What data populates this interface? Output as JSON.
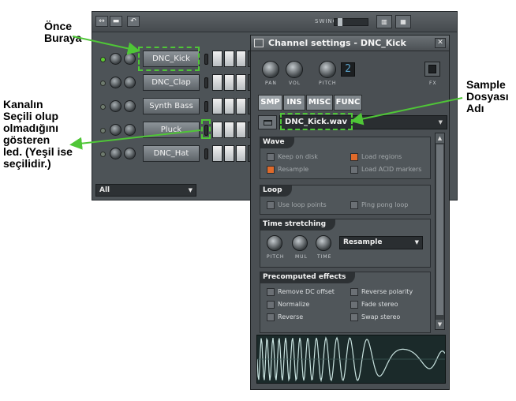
{
  "annotations": {
    "once": "Önce\nBuraya",
    "kanal": "Kanalın\nSeçili olup\nolmadığını\ngösteren\nled. (Yeşil ise\nseçilidir.)",
    "sample": "Sample\nDosyası\nAdı"
  },
  "rack": {
    "swing_label": "SWING",
    "channels": [
      {
        "name": "DNC_Kick",
        "selected": true
      },
      {
        "name": "DNC_Clap",
        "selected": false
      },
      {
        "name": "Synth Bass",
        "selected": false
      },
      {
        "name": "Pluck",
        "selected": false
      },
      {
        "name": "DNC_Hat",
        "selected": false
      }
    ],
    "filter": "All"
  },
  "channel_settings": {
    "title": "Channel settings - DNC_Kick",
    "knob_labels": {
      "pan": "PAN",
      "vol": "VOL",
      "pitch": "PITCH",
      "fx": "FX"
    },
    "pitch_range": "2",
    "tabs": [
      "SMP",
      "INS",
      "MISC",
      "FUNC"
    ],
    "sample_file": "DNC_Kick.wav",
    "wave": {
      "title": "Wave",
      "options": [
        {
          "label": "Keep on disk",
          "checked": false
        },
        {
          "label": "Load regions",
          "checked": true
        },
        {
          "label": "Resample",
          "checked": true
        },
        {
          "label": "Load ACID markers",
          "checked": false
        }
      ]
    },
    "loop": {
      "title": "Loop",
      "options": [
        {
          "label": "Use loop points",
          "checked": false
        },
        {
          "label": "Ping pong loop",
          "checked": false
        }
      ]
    },
    "time_stretching": {
      "title": "Time stretching",
      "knob_labels": [
        "PITCH",
        "MUL",
        "TIME"
      ],
      "mode": "Resample"
    },
    "precomputed": {
      "title": "Precomputed effects",
      "options": [
        {
          "label": "Remove DC offset",
          "checked": false
        },
        {
          "label": "Reverse polarity",
          "checked": false
        },
        {
          "label": "Normalize",
          "checked": false
        },
        {
          "label": "Fade stereo",
          "checked": false
        },
        {
          "label": "Reverse",
          "checked": false
        },
        {
          "label": "Swap stereo",
          "checked": false
        }
      ]
    }
  },
  "colors": {
    "highlight": "#4fc637",
    "checked": "#e06a2a",
    "led_on": "#5ecb32"
  }
}
